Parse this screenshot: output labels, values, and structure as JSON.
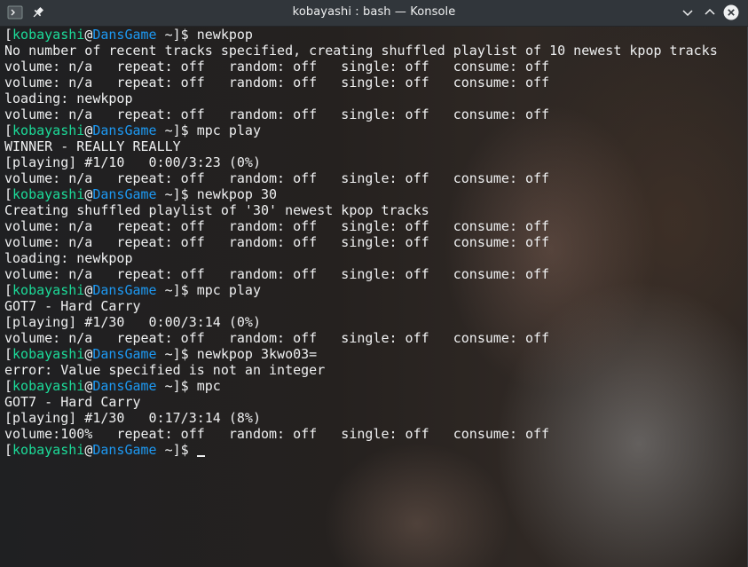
{
  "window": {
    "title": "kobayashi : bash — Konsole"
  },
  "icons": {
    "app": "terminal-app-icon",
    "pin": "pin-icon",
    "minimize": "chevron-down-icon",
    "maximize": "chevron-up-icon",
    "close": "close-icon"
  },
  "prompt": {
    "open": "[",
    "user": "kobayashi",
    "at": "@",
    "host": "DansGame",
    "dir": " ~",
    "close": "]$ "
  },
  "colors": {
    "user": "#1cdc9a",
    "host": "#1d99f3",
    "text": "#eff0f1",
    "titlebar": "#31363b"
  },
  "terminal_lines": [
    {
      "type": "prompt",
      "cmd": "newkpop"
    },
    {
      "type": "output",
      "text": "No number of recent tracks specified, creating shuffled playlist of 10 newest kpop tracks"
    },
    {
      "type": "output",
      "text": "volume: n/a   repeat: off   random: off   single: off   consume: off"
    },
    {
      "type": "output",
      "text": "volume: n/a   repeat: off   random: off   single: off   consume: off"
    },
    {
      "type": "output",
      "text": "loading: newkpop"
    },
    {
      "type": "output",
      "text": "volume: n/a   repeat: off   random: off   single: off   consume: off"
    },
    {
      "type": "prompt",
      "cmd": "mpc play"
    },
    {
      "type": "output",
      "text": "WINNER - REALLY REALLY"
    },
    {
      "type": "output",
      "text": "[playing] #1/10   0:00/3:23 (0%)"
    },
    {
      "type": "output",
      "text": "volume: n/a   repeat: off   random: off   single: off   consume: off"
    },
    {
      "type": "prompt",
      "cmd": "newkpop 30"
    },
    {
      "type": "output",
      "text": "Creating shuffled playlist of '30' newest kpop tracks"
    },
    {
      "type": "output",
      "text": "volume: n/a   repeat: off   random: off   single: off   consume: off"
    },
    {
      "type": "output",
      "text": "volume: n/a   repeat: off   random: off   single: off   consume: off"
    },
    {
      "type": "output",
      "text": "loading: newkpop"
    },
    {
      "type": "output",
      "text": "volume: n/a   repeat: off   random: off   single: off   consume: off"
    },
    {
      "type": "prompt",
      "cmd": "mpc play"
    },
    {
      "type": "output",
      "text": "GOT7 - Hard Carry"
    },
    {
      "type": "output",
      "text": "[playing] #1/30   0:00/3:14 (0%)"
    },
    {
      "type": "output",
      "text": "volume: n/a   repeat: off   random: off   single: off   consume: off"
    },
    {
      "type": "prompt",
      "cmd": "newkpop 3kwo03="
    },
    {
      "type": "output",
      "text": "error: Value specified is not an integer"
    },
    {
      "type": "prompt",
      "cmd": "mpc"
    },
    {
      "type": "output",
      "text": "GOT7 - Hard Carry"
    },
    {
      "type": "output",
      "text": "[playing] #1/30   0:17/3:14 (8%)"
    },
    {
      "type": "output",
      "text": "volume:100%   repeat: off   random: off   single: off   consume: off"
    },
    {
      "type": "prompt",
      "cmd": "",
      "cursor": true
    }
  ]
}
